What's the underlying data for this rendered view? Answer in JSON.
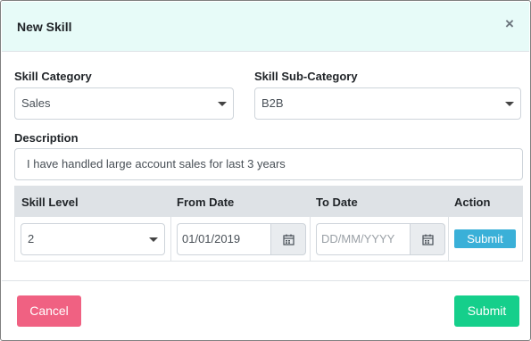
{
  "modal": {
    "title": "New Skill",
    "close_symbol": "×",
    "close_icon": "close-icon"
  },
  "form": {
    "category_label": "Skill Category",
    "category_value": "Sales",
    "subcategory_label": "Skill Sub-Category",
    "subcategory_value": "B2B",
    "description_label": "Description",
    "description_value": "I have handled large account sales for last 3 years"
  },
  "table": {
    "headers": [
      "Skill Level",
      "From Date",
      "To Date",
      "Action"
    ],
    "row": {
      "skill_level": "2",
      "from_date": "01/01/2019",
      "to_date_placeholder": "DD/MM/YYYY",
      "action_label": "Submit"
    }
  },
  "footer": {
    "cancel_label": "Cancel",
    "submit_label": "Submit"
  },
  "colors": {
    "header_bg": "#e7fbf8",
    "cancel": "#f06182",
    "submit": "#15cf8b",
    "row_submit": "#3ab0d8"
  }
}
